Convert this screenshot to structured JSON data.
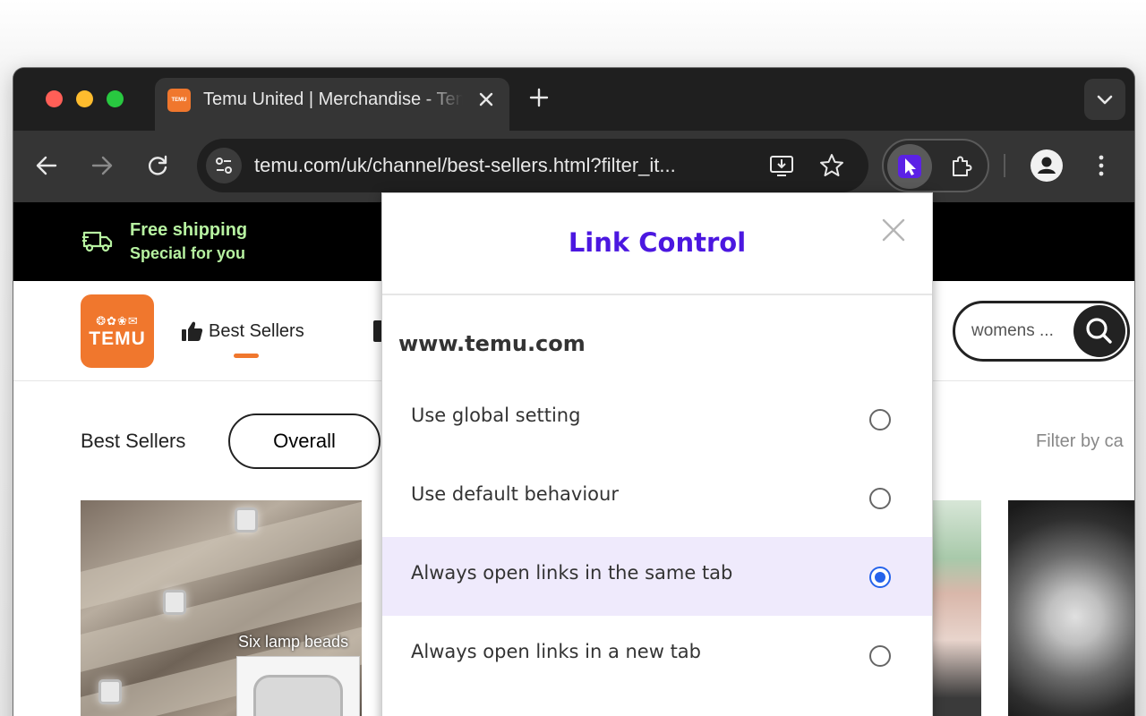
{
  "browser": {
    "tab": {
      "favicon_text": "TEMU",
      "title": "Temu United | Merchandise - Temu"
    },
    "address_bar": {
      "url": "temu.com/uk/channel/best-sellers.html?filter_it..."
    }
  },
  "site": {
    "promo": {
      "title": "Free shipping",
      "subtitle": "Special for you"
    },
    "logo": {
      "symbols": "❂✿❀✉",
      "word": "TEMU"
    },
    "nav": {
      "best_sellers": "Best Sellers"
    },
    "search": {
      "query": "womens ..."
    },
    "filters": {
      "section_label": "Best Sellers",
      "overall_label": "Overall",
      "filter_by_label": "Filter by ca"
    },
    "products": [
      {
        "label": "Six lamp beads"
      }
    ]
  },
  "popup": {
    "title": "Link Control",
    "domain": "www.temu.com",
    "options": [
      {
        "label": "Use global setting",
        "selected": false
      },
      {
        "label": "Use default behaviour",
        "selected": false
      },
      {
        "label": "Always open links in the same tab",
        "selected": true
      },
      {
        "label": "Always open links in a new tab",
        "selected": false
      }
    ]
  },
  "colors": {
    "brand_orange": "#f0772d",
    "popup_accent": "#4b17e0",
    "selected_row": "#efeafc",
    "radio_checked": "#2563eb",
    "promo_green": "#b7f2a1"
  },
  "icons": [
    "close-icon",
    "plus-icon",
    "chevron-down-icon",
    "back-arrow-icon",
    "forward-arrow-icon",
    "reload-icon",
    "site-settings-icon",
    "install-icon",
    "star-icon",
    "cursor-extension-icon",
    "puzzle-icon",
    "profile-icon",
    "menu-dots-icon",
    "truck-icon",
    "thumbs-up-icon",
    "search-icon"
  ]
}
